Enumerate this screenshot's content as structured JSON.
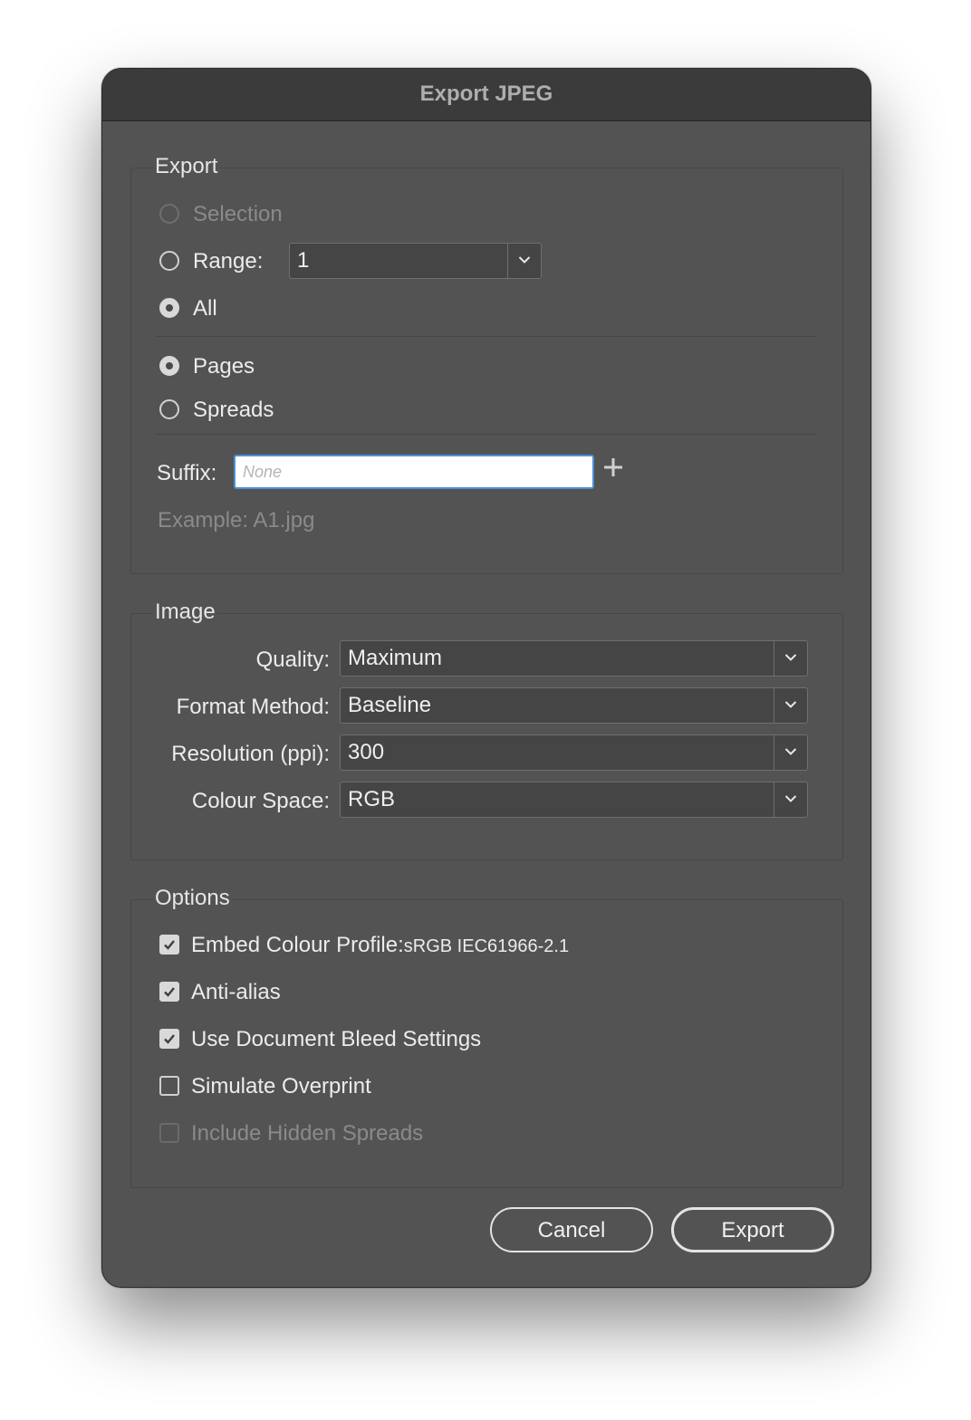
{
  "dialog": {
    "title": "Export JPEG"
  },
  "export": {
    "group_title": "Export",
    "selection_label": "Selection",
    "range_label": "Range:",
    "range_value": "1",
    "all_label": "All",
    "pages_label": "Pages",
    "spreads_label": "Spreads",
    "suffix_label": "Suffix:",
    "suffix_value": "",
    "suffix_placeholder": "None",
    "example_text": "Example: A1.jpg"
  },
  "image": {
    "group_title": "Image",
    "quality_label": "Quality:",
    "quality_value": "Maximum",
    "format_label": "Format Method:",
    "format_value": "Baseline",
    "resolution_label": "Resolution (ppi):",
    "resolution_value": "300",
    "colour_space_label": "Colour Space:",
    "colour_space_value": "RGB"
  },
  "options": {
    "group_title": "Options",
    "embed_profile_label": "Embed Colour Profile:",
    "embed_profile_value": "sRGB IEC61966-2.1",
    "anti_alias_label": "Anti-alias",
    "bleed_label": "Use Document Bleed Settings",
    "overprint_label": "Simulate Overprint",
    "hidden_spreads_label": "Include Hidden Spreads"
  },
  "buttons": {
    "cancel_label": "Cancel",
    "export_label": "Export"
  },
  "state": {
    "selection_enabled": false,
    "range_selected": false,
    "all_selected": true,
    "pages_selected": true,
    "spreads_selected": false,
    "embed_profile_checked": true,
    "anti_alias_checked": true,
    "bleed_checked": true,
    "overprint_checked": false,
    "hidden_spreads_checked": false,
    "hidden_spreads_enabled": false
  },
  "icons": {
    "dropdown": "chevron-down-icon",
    "add": "plus-icon",
    "check": "checkmark-icon"
  },
  "colors": {
    "dialog_bg": "#535353",
    "titlebar_bg": "#3b3b3b",
    "focus_ring": "#4d8fd8"
  }
}
